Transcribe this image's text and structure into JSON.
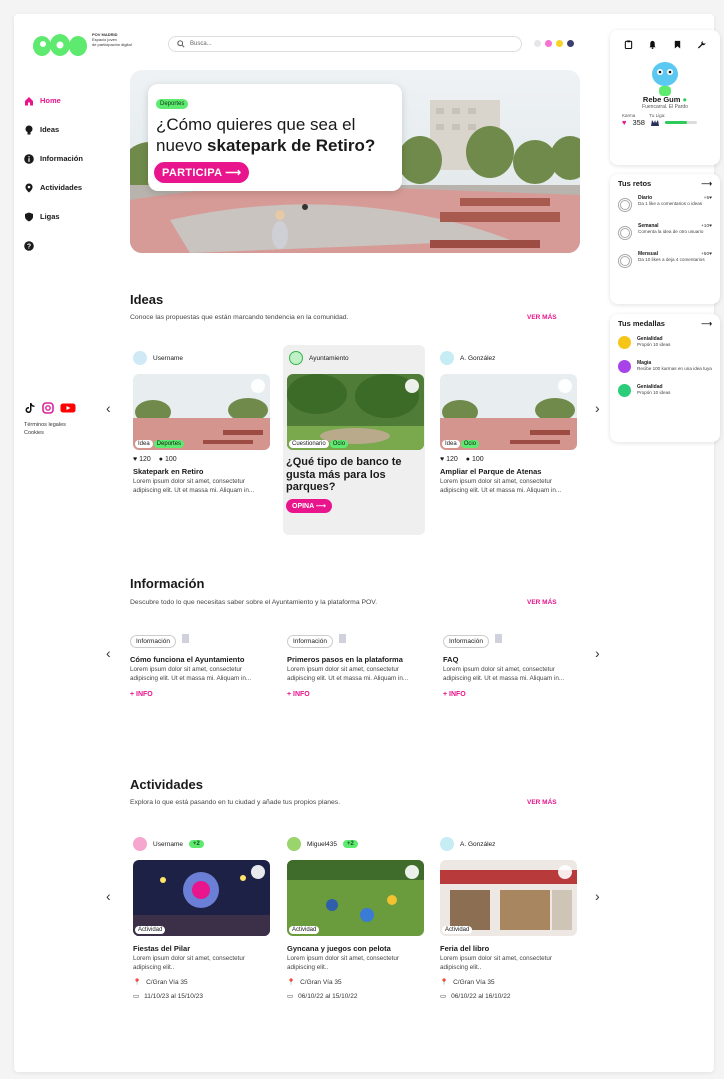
{
  "brand": {
    "logo_text": "POV",
    "line1": "POV MADRID",
    "line2": "Espacio joven",
    "line3": "de participación digital"
  },
  "search": {
    "placeholder": "Busca..."
  },
  "theme_dots": [
    "#e6e6ea",
    "#f472d0",
    "#f5d426",
    "#3a3f6b"
  ],
  "nav": {
    "items": [
      {
        "label": "Home",
        "icon": "home-icon"
      },
      {
        "label": "Ideas",
        "icon": "bulb-icon"
      },
      {
        "label": "Información",
        "icon": "info-icon"
      },
      {
        "label": "Actividades",
        "icon": "pin-icon"
      },
      {
        "label": "Ligas",
        "icon": "shield-icon"
      },
      {
        "label": "",
        "icon": "help-icon"
      }
    ]
  },
  "footer": {
    "legal": "Términos legales",
    "cookies": "Cookies"
  },
  "hero": {
    "tag": "Deportes",
    "q_line1": "¿Cómo quieres que sea el",
    "q_line2_pre": "nuevo ",
    "q_line2_bold": "skatepark de Retiro?",
    "cta": "PARTICIPA ⟶"
  },
  "profile": {
    "name": "Rebe Gum",
    "location": "Fuencarral. El Pardo",
    "karma_label": "Karma",
    "league_label": "Tu Liga:",
    "karma": "358",
    "league_progress": 0.7
  },
  "retos": {
    "title": "Tus retos",
    "items": [
      {
        "name": "Diario",
        "pts": "+5",
        "desc": "Da 1 like a comentarios o ideas"
      },
      {
        "name": "Semanal",
        "pts": "+10",
        "desc": "Comenta la idea de otro usuario"
      },
      {
        "name": "Mensual",
        "pts": "+50",
        "desc": "Da 10 likes a deja 4 comentarios"
      }
    ]
  },
  "medallas": {
    "title": "Tus medallas",
    "items": [
      {
        "name": "Genialidad",
        "desc": "Propón 10 ideas",
        "color": "#f5c518"
      },
      {
        "name": "Magia",
        "desc": "Recibe 100 karmas en una idea tuya",
        "color": "#a743e8"
      },
      {
        "name": "Genialidad",
        "desc": "Propón 10 ideas",
        "color": "#2bcc7a"
      }
    ]
  },
  "ideas": {
    "title": "Ideas",
    "subtitle": "Conoce las propuestas que están marcando tendencia en la comunidad.",
    "more": "VER MÁS",
    "cards": [
      {
        "user": "Username",
        "type": "Idea",
        "tag": "Deportes",
        "likes": "120",
        "comments": "100",
        "title": "Skatepark en Retiro",
        "body": "Lorem ipsum dolor sit amet, consectetur adipiscing elit. Ut et massa mi. Aliquam in..."
      },
      {
        "user": "Ayuntamiento",
        "type": "Cuestionario",
        "tag": "Ocio",
        "title": "¿Qué tipo de banco te gusta más para los parques?",
        "cta": "OPINA ⟶"
      },
      {
        "user": "A. González",
        "type": "Idea",
        "tag": "Ocio",
        "likes": "120",
        "comments": "100",
        "title": "Ampliar el Parque de Atenas",
        "body": "Lorem ipsum dolor sit amet, consectetur adipiscing elit. Ut et massa mi. Aliquam in..."
      }
    ]
  },
  "info": {
    "title": "Información",
    "subtitle": "Descubre todo lo que necesitas saber sobre el Ayuntamiento y la plataforma POV.",
    "more": "VER MÁS",
    "cards": [
      {
        "pill": "Información",
        "title": "Cómo funciona el Ayuntamiento",
        "body": "Lorem ipsum dolor sit amet, consectetur adipiscing elit. Ut et massa mi. Aliquam in...",
        "link": "+ INFO"
      },
      {
        "pill": "Información",
        "title": "Primeros pasos en la plataforma",
        "body": "Lorem ipsum dolor sit amet, consectetur adipiscing elit. Ut et massa mi. Aliquam in...",
        "link": "+ INFO"
      },
      {
        "pill": "Información",
        "title": "FAQ",
        "body": "Lorem ipsum dolor sit amet, consectetur adipiscing elit. Ut et massa mi. Aliquam in...",
        "link": "+ INFO"
      }
    ]
  },
  "activities": {
    "title": "Actividades",
    "subtitle": "Explora lo que está pasando en tu ciudad y añade tus propios planes.",
    "more": "VER MÁS",
    "cards": [
      {
        "user": "Username",
        "badge": "+2",
        "type": "Actividad",
        "title": "Fiestas del Pilar",
        "body": "Lorem ipsum dolor sit amet, consectetur adipiscing elit..",
        "place": "C/Gran Vía 35",
        "dates": "11/10/23 al 15/10/23"
      },
      {
        "user": "Miguel435",
        "badge": "+2",
        "type": "Actividad",
        "title": "Gyncana y juegos con pelota",
        "body": "Lorem ipsum dolor sit amet, consectetur adipiscing elit..",
        "place": "C/Gran Vía 35",
        "dates": "06/10/22 al 15/10/22"
      },
      {
        "user": "A. González",
        "type": "Actividad",
        "title": "Feria del libro",
        "body": "Lorem ipsum dolor sit amet, consectetur adipiscing elit..",
        "place": "C/Gran Vía 35",
        "dates": "06/10/22 al 16/10/22"
      }
    ]
  },
  "arrows": {
    "left": "‹",
    "right": "›"
  }
}
